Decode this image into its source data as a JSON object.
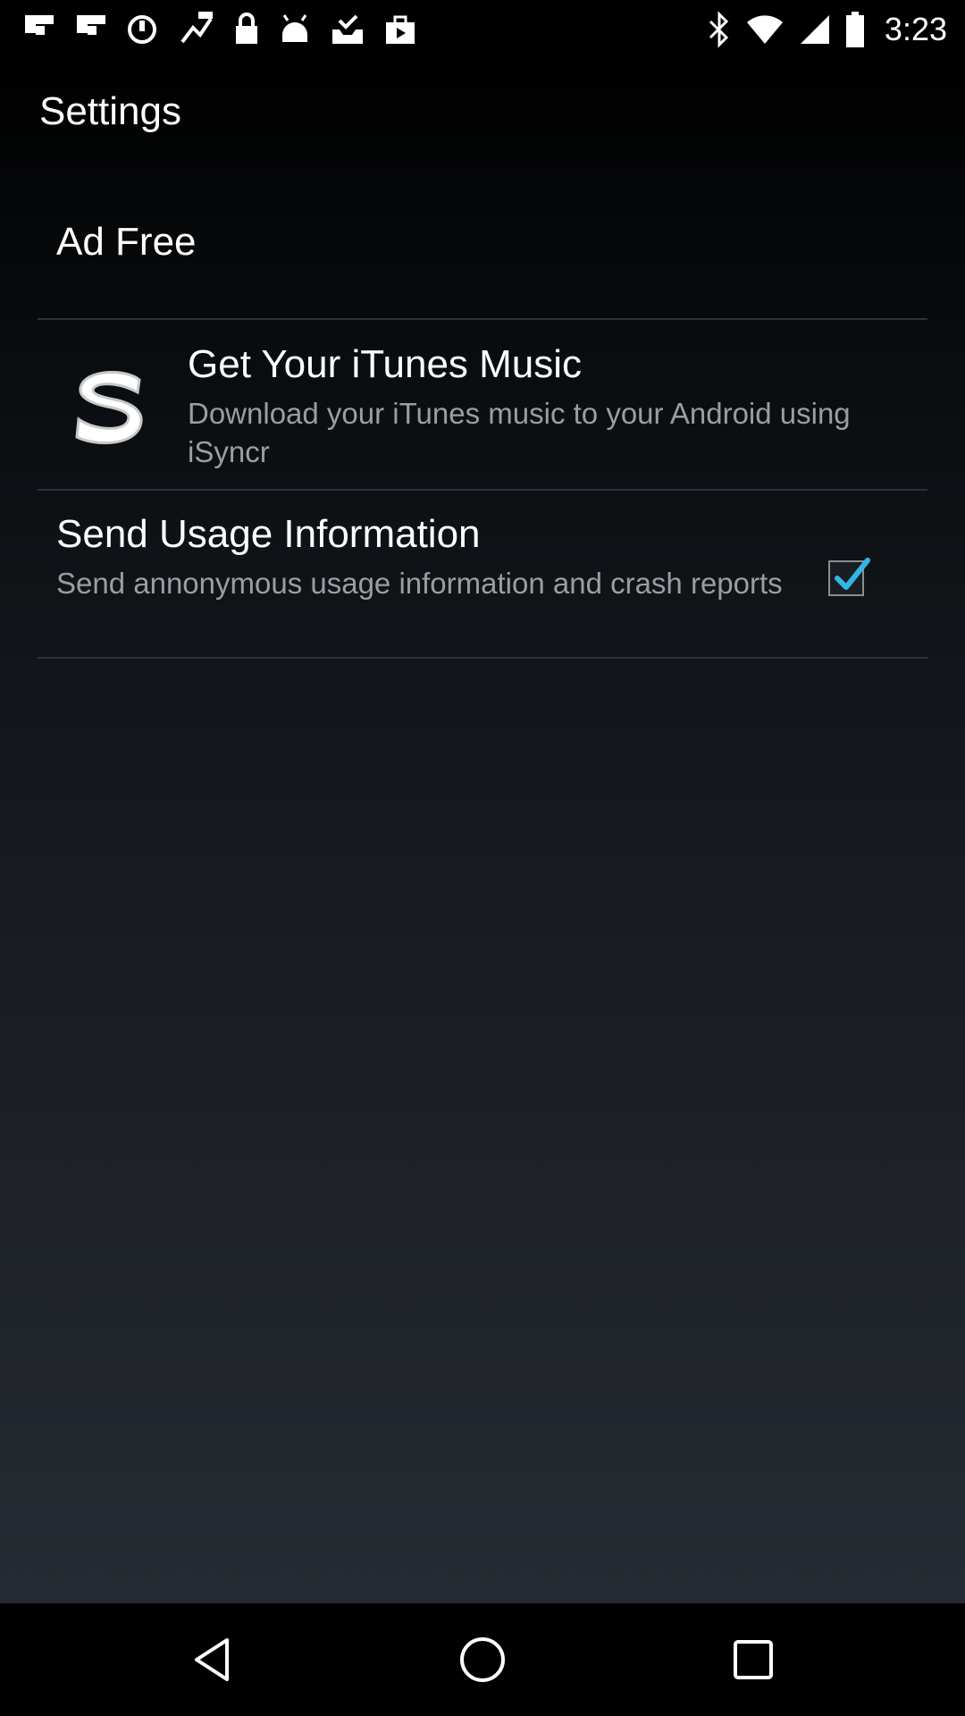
{
  "status_bar": {
    "time": "3:23",
    "left_icons": [
      "flipboard-icon",
      "flipboard-icon",
      "sync-icon",
      "fake-gps-icon",
      "lock-icon",
      "android-icon",
      "inbox-check-icon",
      "shopping-bag-icon"
    ],
    "right_icons": [
      "bluetooth-icon",
      "wifi-icon",
      "signal-icon",
      "battery-icon"
    ]
  },
  "header": {
    "title": "Settings"
  },
  "settings": {
    "ad_free": {
      "label": "Ad Free"
    },
    "itunes": {
      "title": "Get Your iTunes Music",
      "subtitle": "Download your iTunes music to your Android using iSyncr",
      "icon": "isyncr-logo-icon"
    },
    "usage": {
      "title": "Send Usage Information",
      "subtitle": "Send annonymous usage information and crash reports",
      "checked": true
    }
  },
  "nav_bar": {
    "buttons": [
      "back-icon",
      "home-icon",
      "recents-icon"
    ]
  },
  "colors": {
    "accent": "#33b5e5",
    "text_primary": "#ffffff",
    "text_secondary": "#9a9da2",
    "divider": "#2e3238"
  }
}
